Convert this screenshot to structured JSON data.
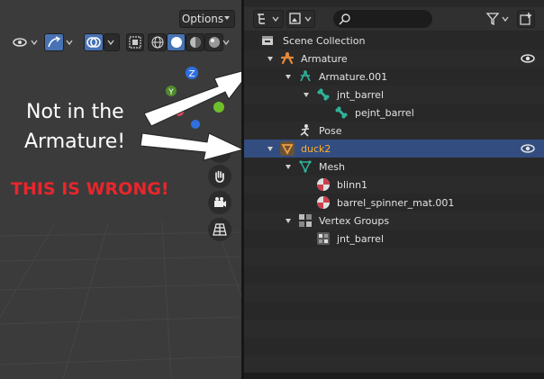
{
  "viewport": {
    "options_label": "Options",
    "gizmo_labels": {
      "z": "Z",
      "y": "Y"
    },
    "annotation_line1": "Not in the",
    "annotation_line2": "Armature!",
    "warning": "THIS IS WRONG!"
  },
  "outliner": {
    "search_value": "",
    "rows": [
      {
        "label": "Scene Collection",
        "icon": "scene-collection-icon"
      },
      {
        "label": "Armature",
        "icon": "armature-object-icon"
      },
      {
        "label": "Armature.001",
        "icon": "armature-data-icon"
      },
      {
        "label": "jnt_barrel",
        "icon": "bone-icon"
      },
      {
        "label": "pejnt_barrel",
        "icon": "bone-icon"
      },
      {
        "label": "Pose",
        "icon": "pose-icon"
      },
      {
        "label": "duck2",
        "icon": "mesh-object-icon"
      },
      {
        "label": "Mesh",
        "icon": "mesh-data-icon"
      },
      {
        "label": "blinn1",
        "icon": "material-icon"
      },
      {
        "label": "barrel_spinner_mat.001",
        "icon": "material-icon"
      },
      {
        "label": "Vertex Groups",
        "icon": "vertex-groups-icon"
      },
      {
        "label": "jnt_barrel",
        "icon": "vertex-group-icon"
      }
    ]
  },
  "colors": {
    "selected_row": "#334d80",
    "selected_text": "#ffaf29",
    "warning": "#e8262c",
    "accent": "#4772b3"
  }
}
